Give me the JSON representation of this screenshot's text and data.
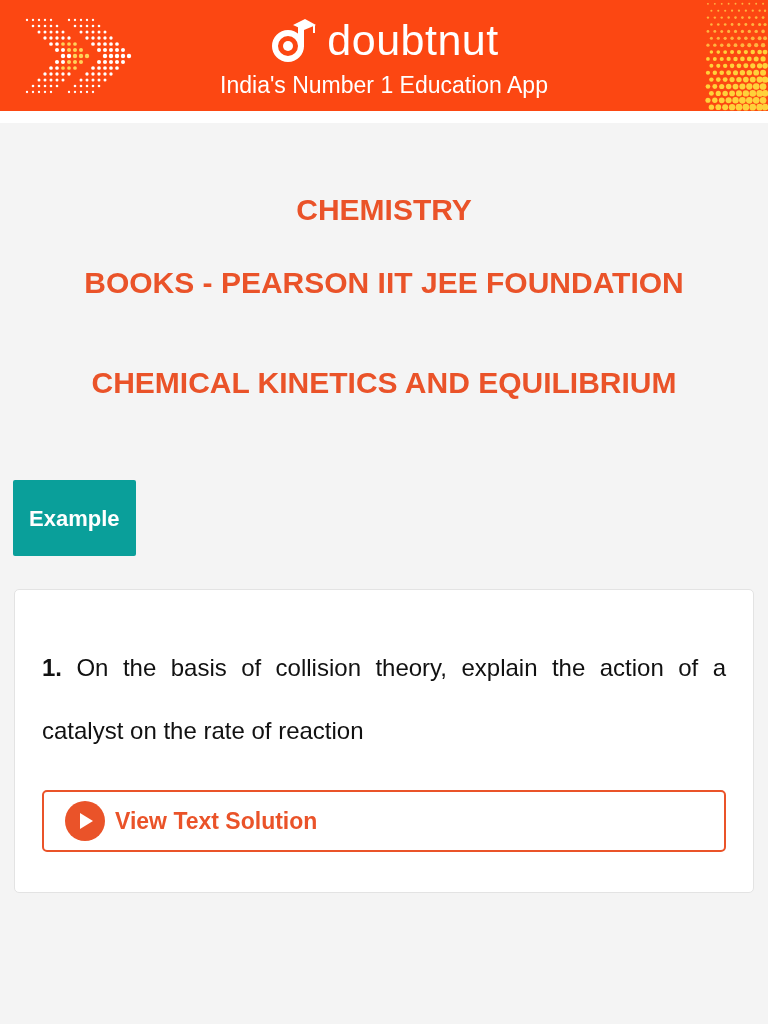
{
  "header": {
    "brand": "doubtnut",
    "tagline": "India's Number 1 Education App"
  },
  "subject": "CHEMISTRY",
  "book": "BOOKS - PEARSON IIT JEE FOUNDATION",
  "chapter": "CHEMICAL KINETICS AND EQUILIBRIUM",
  "section_label": "Example",
  "questions": [
    {
      "text": "**1.** On the basis of collision theory, explain the action of a catalyst on the rate of reaction",
      "button": "View Text Solution"
    }
  ]
}
